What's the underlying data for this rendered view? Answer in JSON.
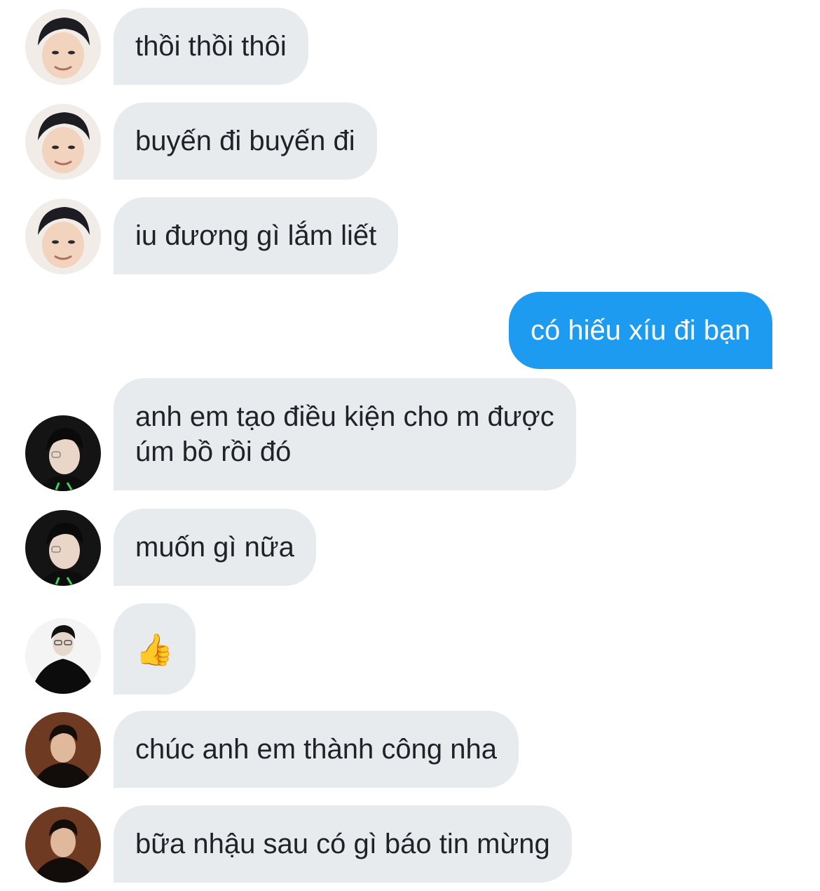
{
  "messages": [
    {
      "text": "thồi thồi thôi",
      "sender": "incoming",
      "avatar": "face-icon"
    },
    {
      "text": "buyến đi buyến đi",
      "sender": "incoming",
      "avatar": "face-icon"
    },
    {
      "text": "iu đương gì lắm liết",
      "sender": "incoming",
      "avatar": "face-icon"
    },
    {
      "text": "có hiếu xíu đi bạn",
      "sender": "outgoing"
    },
    {
      "text": "anh em tạo điều kiện cho m được\núm bồ rồi đó",
      "sender": "incoming",
      "avatar": "face-icon"
    },
    {
      "text": "muốn gì nữa",
      "sender": "incoming",
      "avatar": "face-icon"
    },
    {
      "text": "👍",
      "sender": "incoming",
      "avatar": "face-icon"
    },
    {
      "text": "chúc anh em thành công nha",
      "sender": "incoming",
      "avatar": "face-icon"
    },
    {
      "text": "bữa nhậu sau có gì báo tin mừng",
      "sender": "incoming",
      "avatar": "face-icon"
    }
  ],
  "colors": {
    "incoming_bubble": "#e8ebee",
    "outgoing_bubble": "#1d9bf0",
    "incoming_text": "#1f2328",
    "outgoing_text": "#ffffff"
  }
}
